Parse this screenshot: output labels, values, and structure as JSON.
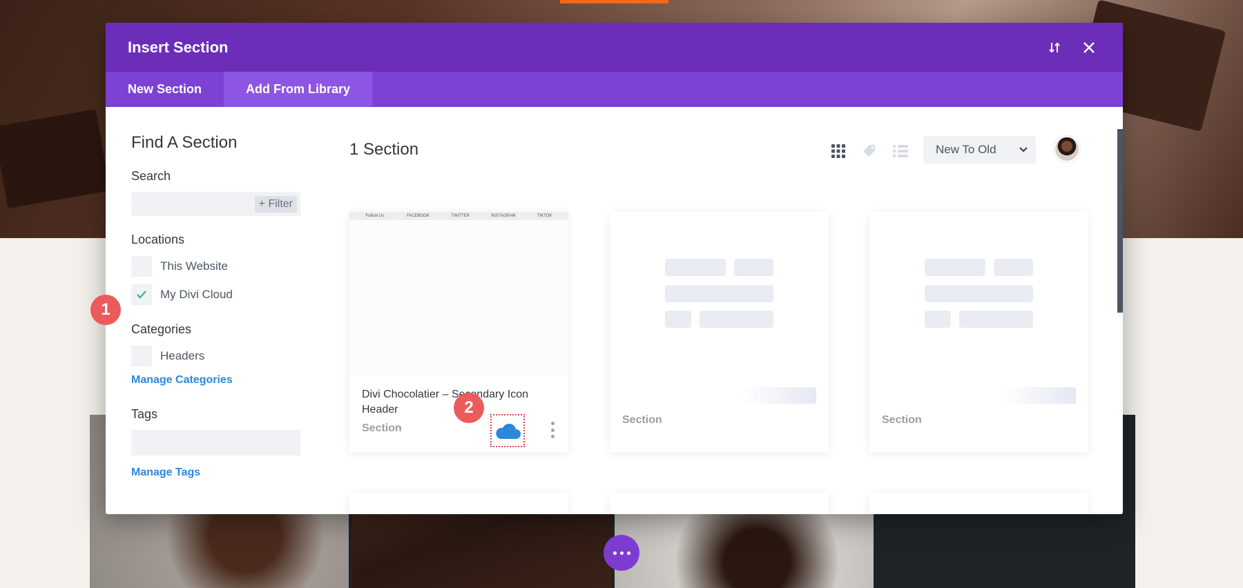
{
  "modal": {
    "title": "Insert Section",
    "tabs": [
      {
        "label": "New Section"
      },
      {
        "label": "Add From Library"
      }
    ]
  },
  "sidebar": {
    "title": "Find A Section",
    "search": {
      "label": "Search",
      "placeholder": "",
      "filter_label": "+ Filter"
    },
    "locations": {
      "label": "Locations",
      "items": [
        {
          "label": "This Website",
          "checked": false
        },
        {
          "label": "My Divi Cloud",
          "checked": true
        }
      ]
    },
    "categories": {
      "label": "Categories",
      "items": [
        {
          "label": "Headers",
          "checked": false
        }
      ],
      "manage_label": "Manage Categories"
    },
    "tags": {
      "label": "Tags",
      "placeholder": "",
      "manage_label": "Manage Tags"
    }
  },
  "main": {
    "count_label": "1 Section",
    "sort": {
      "selected": "New To Old"
    },
    "cards": [
      {
        "name": "Divi Chocolatier – Secondary Icon Header",
        "type": "Section",
        "thumb_links": [
          "Follow Us:",
          "FACEBOOK",
          "TWITTER",
          "INSTAGRAM",
          "TIKTOK"
        ]
      },
      {
        "name": "",
        "type": "Section"
      },
      {
        "name": "",
        "type": "Section"
      }
    ]
  },
  "annotations": {
    "step1": "1",
    "step2": "2"
  },
  "colors": {
    "primary": "#6c2eb9",
    "tabs": "#7b42d4",
    "tab_active": "#8d55e3",
    "link": "#2b87da",
    "badge": "#ec5b5b",
    "cloud": "#2b87da"
  },
  "icons": [
    "sort-icon",
    "close-icon",
    "grid-view-icon",
    "tag-icon",
    "list-view-icon",
    "chevron-down-icon",
    "check-icon",
    "cloud-icon",
    "more-vertical-icon",
    "ellipsis-icon"
  ]
}
